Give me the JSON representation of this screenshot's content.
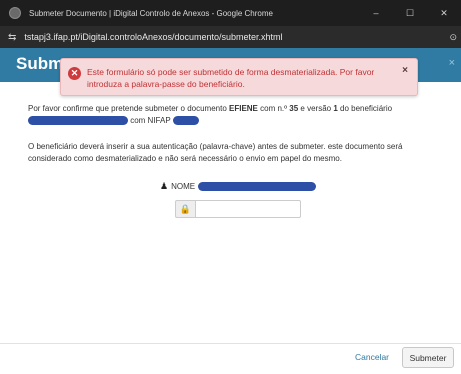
{
  "window": {
    "title": "Submeter Documento | iDigital Controlo de Anexos - Google Chrome",
    "controls": [
      "–",
      "☐",
      "✕"
    ]
  },
  "browser": {
    "url": "tstapj3.ifap.pt/iDigital.controloAnexos/documento/submeter.xhtml"
  },
  "dialog": {
    "title": "Subm",
    "close_glyph": "×"
  },
  "error": {
    "message": "Este formulário só pode ser submetido de forma desmaterializada. Por favor introduza a palavra-passe do beneficiário.",
    "close_glyph": "×"
  },
  "body": {
    "p1_a": "Por favor confirme que pretende submeter o documento ",
    "doc_code": "EFIENE",
    "p1_b": " com n.º ",
    "doc_number": "35",
    "p1_c": " e versão ",
    "version": "1",
    "p1_d": " do beneficiário",
    "p1_e": " com NIFAP ",
    "p2": "O beneficiário deverá inserir a sua autenticação (palavra-chave) antes de submeter. este documento será considerado como desmaterializado e não será necessário o envio em papel do mesmo.",
    "name_label": "NOME"
  },
  "footer": {
    "cancel_label": "Cancelar",
    "submit_label": "Submeter"
  },
  "colors": {
    "header": "#2f7ba3",
    "error_bg": "#f6d9da",
    "error_text": "#c13236",
    "redaction": "#2d4fa6"
  }
}
